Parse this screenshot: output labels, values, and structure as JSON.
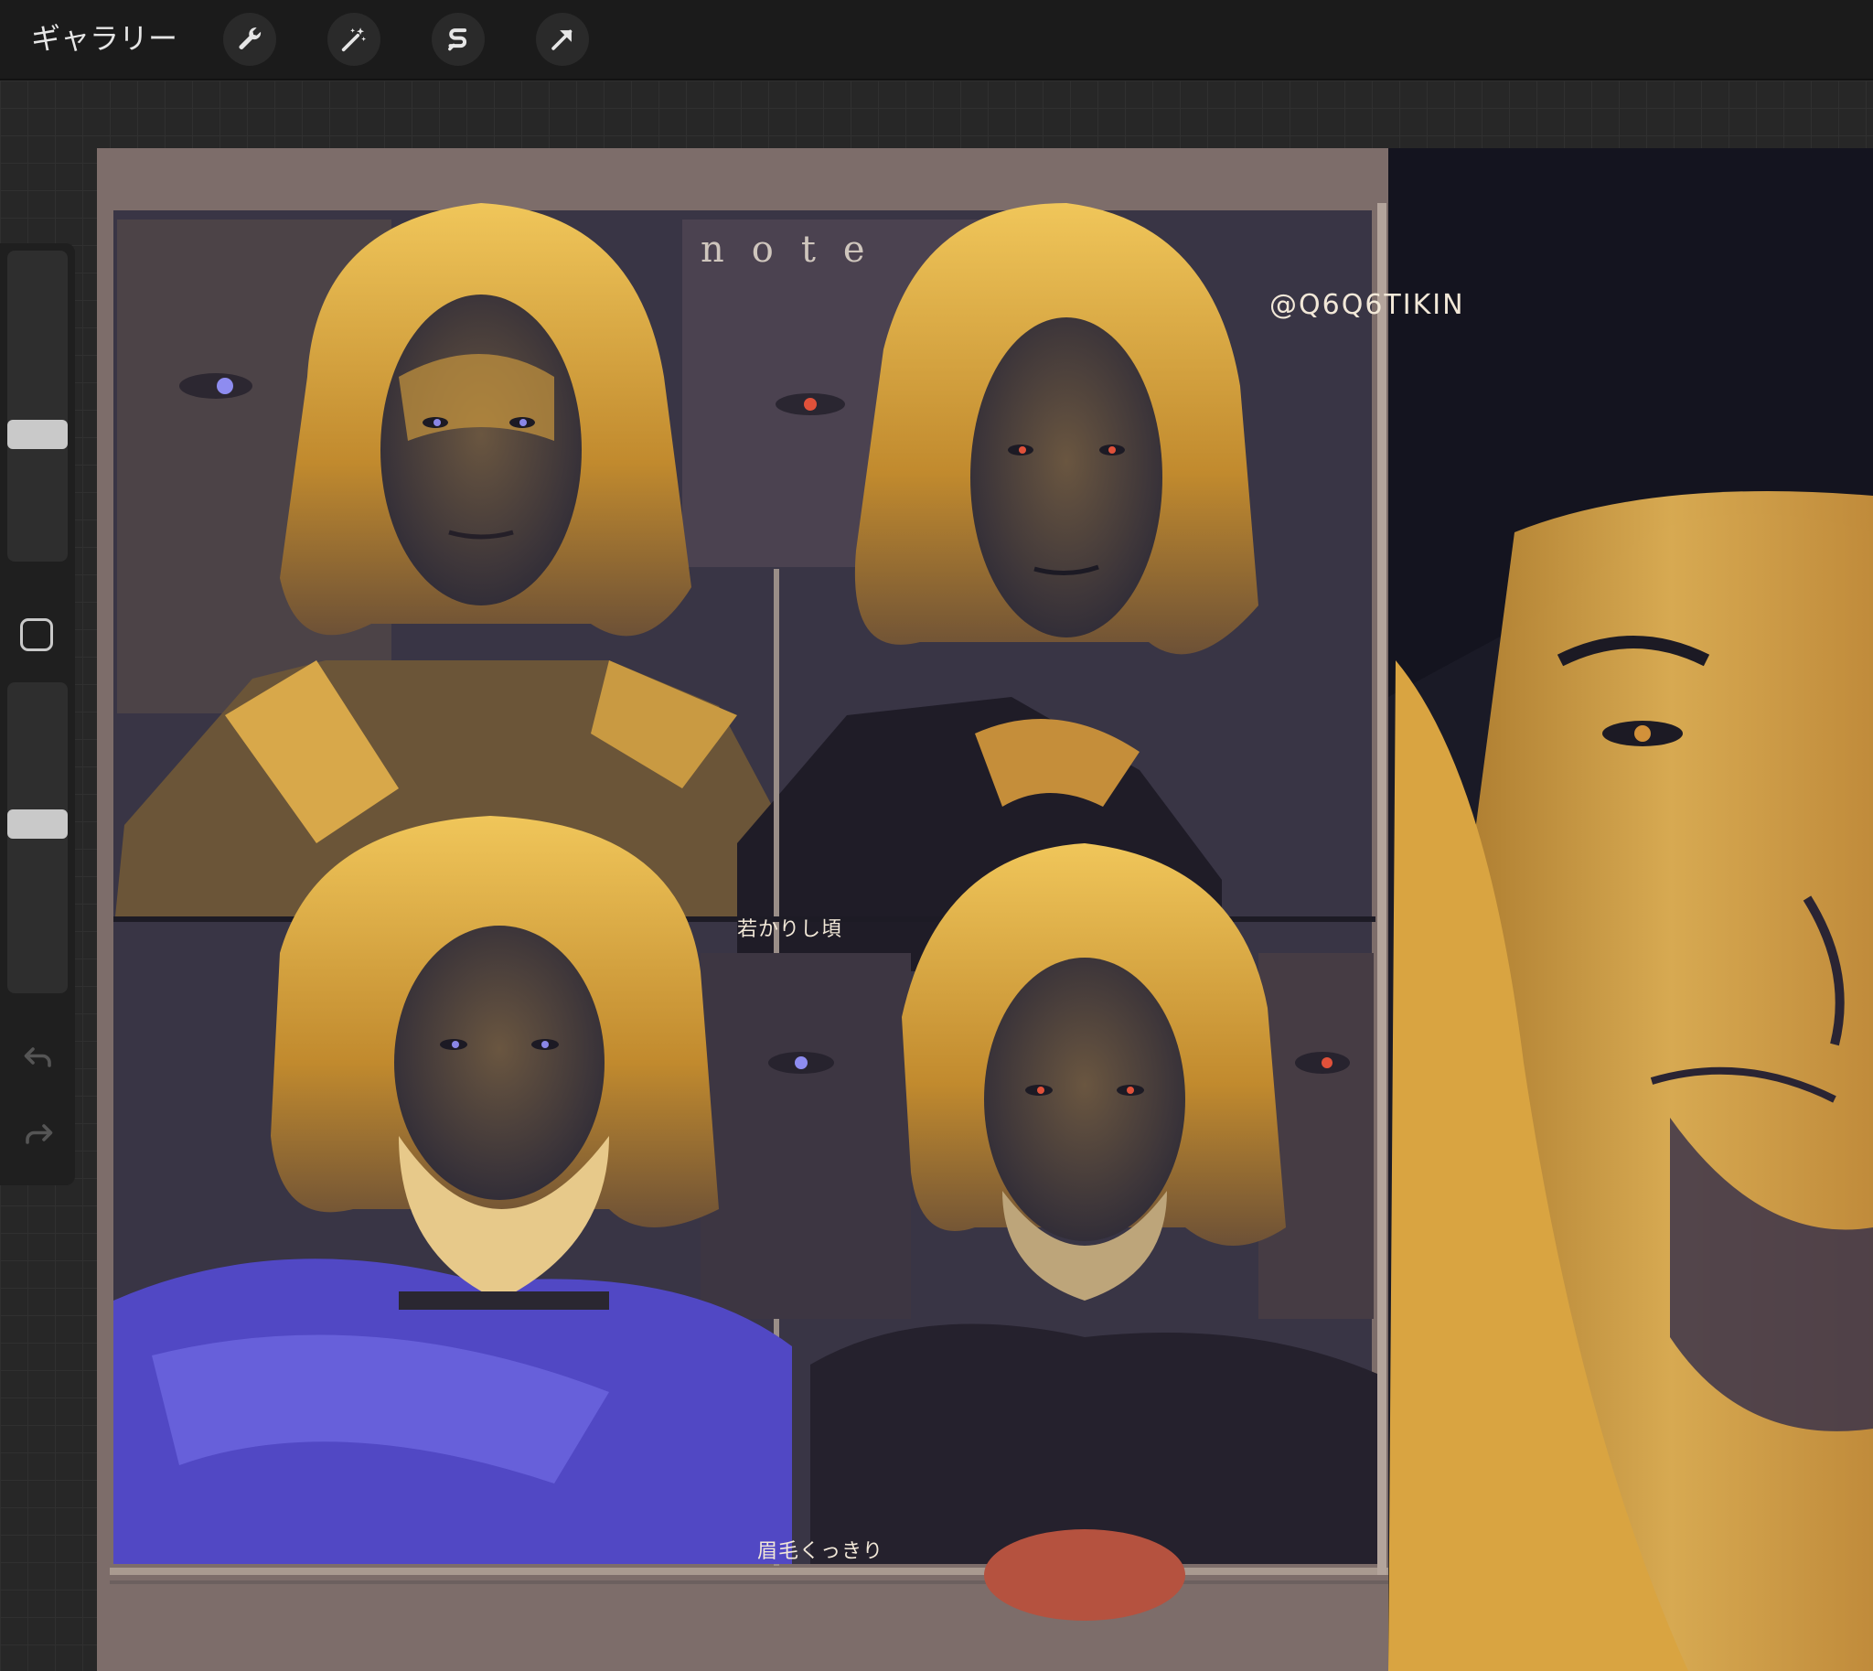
{
  "toolbar": {
    "gallery_label": "ギャラリー",
    "tools": [
      {
        "name": "actions-wrench",
        "icon": "wrench-icon"
      },
      {
        "name": "adjustments",
        "icon": "magic-wand-icon"
      },
      {
        "name": "selection",
        "icon": "selection-s-icon"
      },
      {
        "name": "transform",
        "icon": "arrow-cursor-icon"
      }
    ]
  },
  "sidebar": {
    "brush_size_level": 0.4,
    "opacity_level": 0.55,
    "modify_icon": "square-icon",
    "undo_icon": "undo-icon",
    "redo_icon": "redo-icon"
  },
  "canvas": {
    "note_text": "note",
    "signature": "@Q6Q6TIKIN",
    "caption_young": "若かりし頃",
    "caption_eyebrows": "眉毛くっきり"
  },
  "colors": {
    "toolbar_bg": "#1b1b1b",
    "canvas_bg": "#7d6d6a",
    "gold": "#d9a441",
    "shadow_navy": "#2a2838",
    "violet": "#5d55d6",
    "red_eye": "#e0513a"
  }
}
